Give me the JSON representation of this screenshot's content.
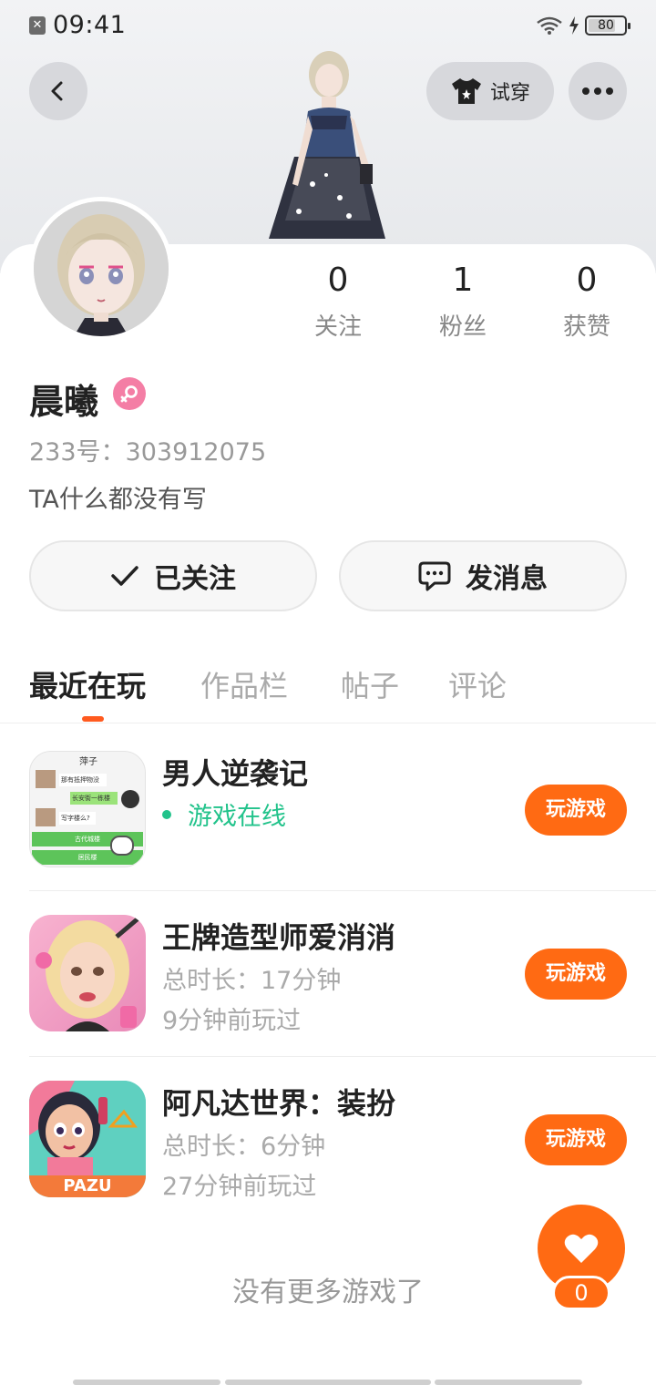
{
  "status_bar": {
    "time": "09:41",
    "battery": "80"
  },
  "header": {
    "tryon_label": "试穿"
  },
  "profile": {
    "stats": [
      {
        "value": "0",
        "label": "关注"
      },
      {
        "value": "1",
        "label": "粉丝"
      },
      {
        "value": "0",
        "label": "获赞"
      }
    ],
    "name": "晨曦",
    "uid": "233号：303912075",
    "bio": "TA什么都没有写",
    "follow_label": "已关注",
    "message_label": "发消息"
  },
  "tabs": [
    "最近在玩",
    "作品栏",
    "帖子",
    "评论"
  ],
  "games": [
    {
      "title": "男人逆袭记",
      "status": "游戏在线",
      "play_label": "玩游戏",
      "icon_texts": [
        "萍子",
        "那有抵押物没",
        "长安街一栋楼",
        "写字楼么?",
        "古代城楼",
        "居民楼"
      ]
    },
    {
      "title": "王牌造型师爱消消",
      "duration": "总时长：17分钟",
      "last_played": "9分钟前玩过",
      "play_label": "玩游戏"
    },
    {
      "title": "阿凡达世界：装扮",
      "duration": "总时长：6分钟",
      "last_played": "27分钟前玩过",
      "play_label": "玩游戏",
      "icon_brand": "PAZU"
    }
  ],
  "footer": {
    "no_more": "没有更多游戏了",
    "like_count": "0"
  },
  "colors": {
    "accent": "#ff6a13",
    "online": "#22c38b",
    "gender": "#f47ea5"
  }
}
